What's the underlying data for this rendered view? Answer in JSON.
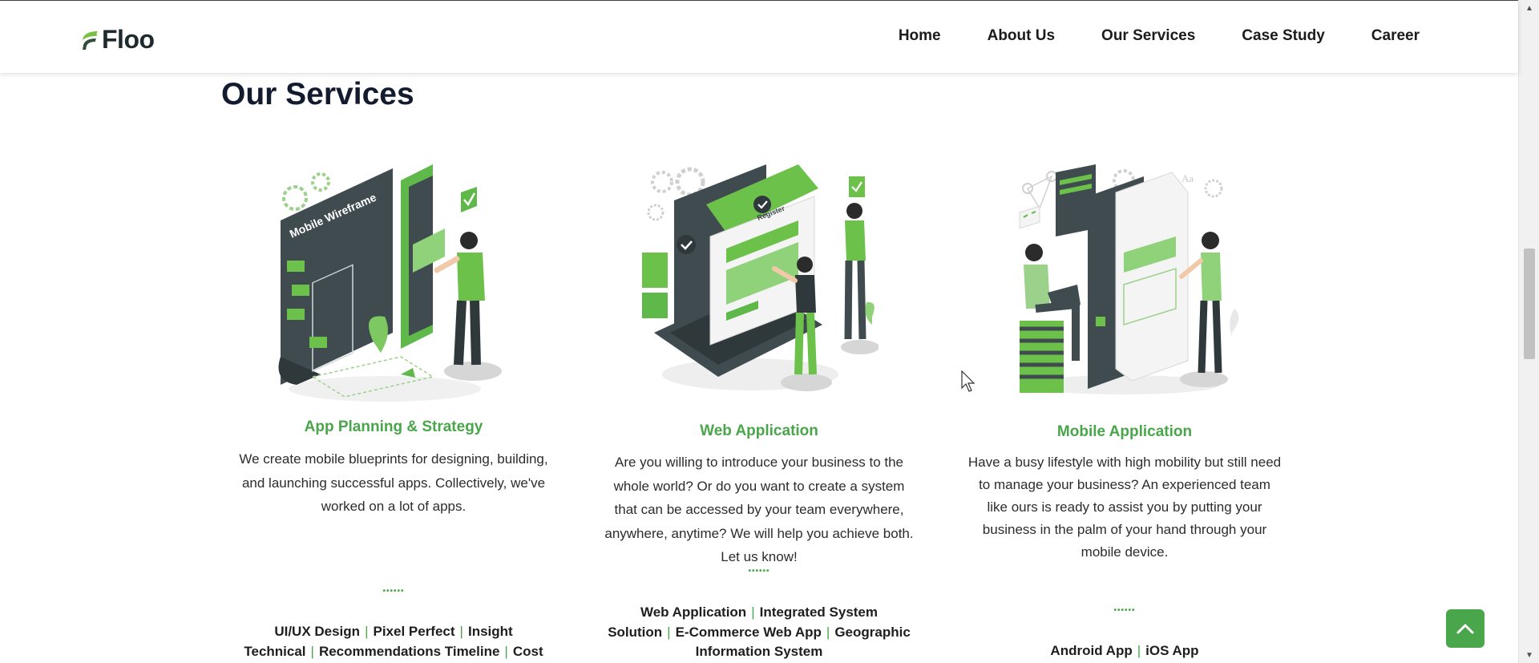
{
  "brand": {
    "name": "Floo",
    "accent": "#4aa64a"
  },
  "nav": {
    "items": [
      {
        "label": "Home"
      },
      {
        "label": "About Us"
      },
      {
        "label": "Our Services"
      },
      {
        "label": "Case Study"
      },
      {
        "label": "Career"
      }
    ]
  },
  "section": {
    "title": "Our Services"
  },
  "services": [
    {
      "title": "App Planning & Strategy",
      "illustration_icon": "mobile-wireframe-illustration",
      "illustration_text": "Mobile Wireframe",
      "description": "We create mobile blueprints for designing, building, and launching successful apps. Collectively, we've worked on a lot of apps.",
      "dots": "••••••",
      "tags": [
        "UI/UX Design",
        "Pixel Perfect",
        "Insight Technical",
        "Recommendations Timeline",
        "Cost Estimates"
      ]
    },
    {
      "title": "Web Application",
      "illustration_icon": "web-app-illustration",
      "illustration_text": "Register",
      "description": "Are you willing to introduce your business to the whole world? Or do you want to create a system that can be accessed by your team everywhere, anywhere, anytime? We will help you achieve both. Let us know!",
      "dots": "••••••",
      "tags": [
        "Web Application",
        "Integrated System Solution",
        "E-Commerce Web App",
        "Geographic Information System"
      ]
    },
    {
      "title": "Mobile Application",
      "illustration_icon": "mobile-app-illustration",
      "illustration_text": "Aa",
      "description": "Have a busy lifestyle with high mobility but still need to manage your business? An experienced team like ours is ready to assist you by putting your business in the palm of your hand through your mobile device.",
      "dots": "••••••",
      "tags": [
        "Android App",
        "iOS App"
      ]
    }
  ],
  "back_to_top": {
    "icon": "chevron-up-icon"
  }
}
